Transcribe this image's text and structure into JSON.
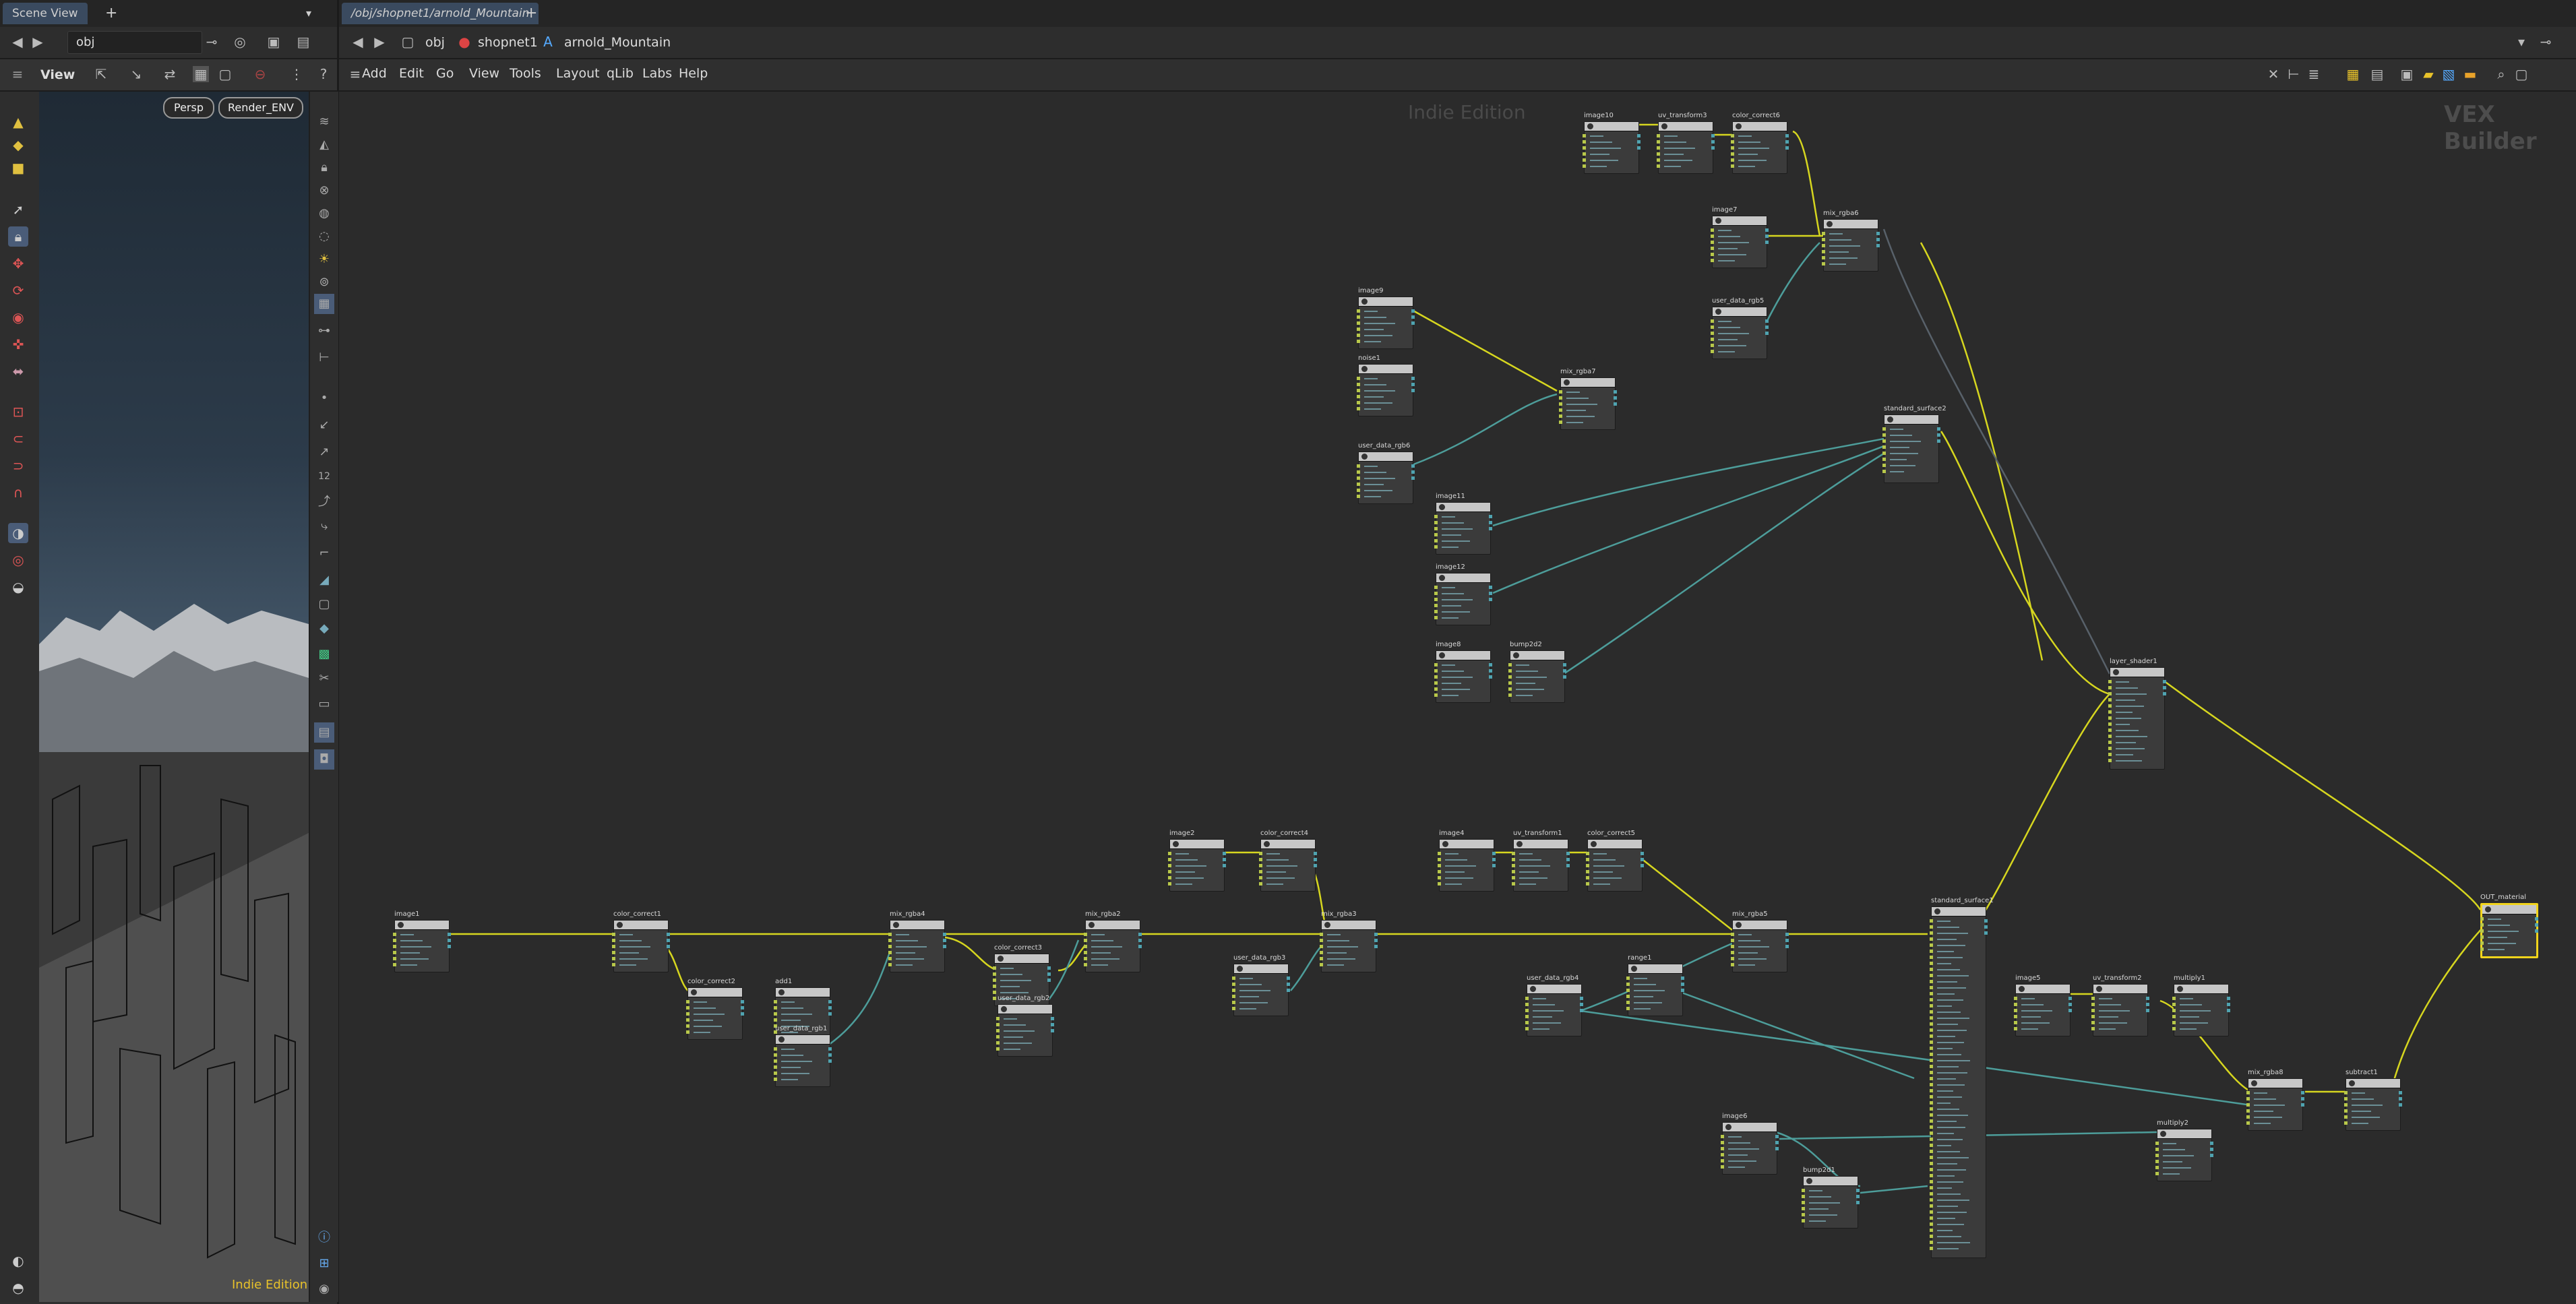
{
  "left_pane": {
    "tab_label": "Scene View",
    "path_value": "obj",
    "view_label": "View",
    "persp_button": "Persp",
    "camera_button": "Render_ENV",
    "watermark": "Indie Edition"
  },
  "right_pane": {
    "tab_label": "/obj/shopnet1/arnold_Mountain",
    "breadcrumbs": [
      "obj",
      "shopnet1",
      "arnold_Mountain"
    ],
    "menu": [
      "Add",
      "Edit",
      "Go",
      "View",
      "Tools",
      "Layout",
      "qLib",
      "Labs",
      "Help"
    ],
    "watermark": "Indie Edition",
    "context_label": "VEX Builder"
  },
  "nodes": [
    {
      "label": "image10"
    },
    {
      "label": "uv_transform3"
    },
    {
      "label": "color_correct6"
    },
    {
      "label": "image7"
    },
    {
      "label": "mix_rgba6"
    },
    {
      "label": "user_data_rgb5"
    },
    {
      "label": "image9"
    },
    {
      "label": "noise1"
    },
    {
      "label": "user_data_rgb6"
    },
    {
      "label": "mix_rgba7"
    },
    {
      "label": "standard_surface2"
    },
    {
      "label": "image11"
    },
    {
      "label": "image12"
    },
    {
      "label": "image8"
    },
    {
      "label": "bump2d2"
    },
    {
      "label": "layer_shader1"
    },
    {
      "label": "image1"
    },
    {
      "label": "color_correct1"
    },
    {
      "label": "color_correct2"
    },
    {
      "label": "add1"
    },
    {
      "label": "user_data_rgb1"
    },
    {
      "label": "mix_rgba4"
    },
    {
      "label": "color_correct3"
    },
    {
      "label": "user_data_rgb2"
    },
    {
      "label": "mix_rgba2"
    },
    {
      "label": "image2"
    },
    {
      "label": "color_correct4"
    },
    {
      "label": "user_data_rgb3"
    },
    {
      "label": "mix_rgba3"
    },
    {
      "label": "image4"
    },
    {
      "label": "uv_transform1"
    },
    {
      "label": "color_correct5"
    },
    {
      "label": "user_data_rgb4"
    },
    {
      "label": "range1"
    },
    {
      "label": "mix_rgba5"
    },
    {
      "label": "standard_surface1"
    },
    {
      "label": "image5"
    },
    {
      "label": "uv_transform2"
    },
    {
      "label": "multiply1"
    },
    {
      "label": "mix_rgba8"
    },
    {
      "label": "subtract1"
    },
    {
      "label": "image6"
    },
    {
      "label": "bump2d1"
    },
    {
      "label": "multiply2"
    },
    {
      "label": "OUT_material"
    }
  ],
  "icons": [
    "back-icon",
    "forward-icon",
    "pin-icon",
    "gear-icon",
    "plus-icon",
    "menu-icon"
  ]
}
